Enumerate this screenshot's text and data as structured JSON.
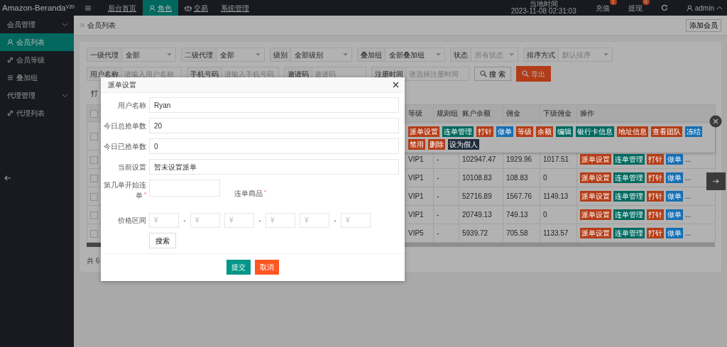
{
  "top_bar": {
    "logo": "Amazon-Beranda",
    "version": "V20",
    "nav": [
      {
        "label": "后台首页",
        "selected": false
      },
      {
        "label": "角色",
        "selected": true
      },
      {
        "label": "交易",
        "selected": false
      },
      {
        "label": "系统管理",
        "selected": false
      }
    ],
    "time_label": "当地时间",
    "time": "2023-11-08 02:31:03",
    "actions": [
      {
        "label": "充值",
        "badge": "1"
      },
      {
        "label": "提现",
        "badge": "0"
      }
    ],
    "user": "admin"
  },
  "sidebar": {
    "groups": [
      {
        "label": "会员管理",
        "expanded": true,
        "children": [
          {
            "label": "会员列表",
            "selected": true
          },
          {
            "label": "会员等级",
            "selected": false
          },
          {
            "label": "叠加组",
            "selected": false
          }
        ]
      },
      {
        "label": "代理管理",
        "expanded": true,
        "children": [
          {
            "label": "代理列表",
            "selected": false
          }
        ]
      }
    ]
  },
  "breadcrumb": "会员列表",
  "add_button": "添加会员",
  "filters": {
    "selects": [
      {
        "label": "一级代理",
        "value": "全部"
      },
      {
        "label": "二级代理",
        "value": "全部"
      },
      {
        "label": "级别",
        "value": "全部级别"
      },
      {
        "label": "叠加组",
        "value": "全部叠加组"
      },
      {
        "label": "状态",
        "placeholder": "所有状态"
      },
      {
        "label": "排序方式",
        "placeholder": "默认排序"
      }
    ],
    "inputs": [
      {
        "label": "用户名称",
        "placeholder": "请输入用户名称"
      },
      {
        "label": "手机号码",
        "placeholder": "请输入手机号码"
      },
      {
        "label": "邀请码",
        "placeholder": "邀请码"
      },
      {
        "label": "注册时间",
        "placeholder": "请选择注册时间"
      }
    ],
    "search_button": "搜 索",
    "export_button": "导出",
    "row_3_text": "打"
  },
  "table": {
    "header_checked": false,
    "columns": [
      "等级",
      "规则组",
      "账户余额",
      "佣金",
      "下级佣金",
      "操作"
    ],
    "rows": [
      {
        "checked": false
      },
      {
        "checked": false,
        "cells": [
          "VIP1",
          "-",
          "102947.47",
          "1929.96",
          "1017.51"
        ],
        "actions": [
          {
            "label": "派单设置",
            "color": "#b33d18"
          },
          {
            "label": "连单管理",
            "color": "#00695f"
          },
          {
            "label": "打针",
            "color": "#b33d18"
          },
          {
            "label": "做单",
            "color": "#156fb3"
          }
        ],
        "more": "..."
      },
      {
        "checked": false,
        "cells": [
          "VIP1",
          "-",
          "10108.83",
          "108.83",
          "0"
        ],
        "actions": [
          {
            "label": "派单设置",
            "color": "#b33d18"
          },
          {
            "label": "连单管理",
            "color": "#00695f"
          },
          {
            "label": "打针",
            "color": "#b33d18"
          },
          {
            "label": "做单",
            "color": "#156fb3"
          }
        ],
        "more": "..."
      },
      {
        "checked": false,
        "cells": [
          "VIP1",
          "-",
          "52716.89",
          "1567.76",
          "1149.13"
        ],
        "actions": [
          {
            "label": "派单设置",
            "color": "#b33d18"
          },
          {
            "label": "连单管理",
            "color": "#00695f"
          },
          {
            "label": "打针",
            "color": "#b33d18"
          },
          {
            "label": "做单",
            "color": "#156fb3"
          }
        ],
        "more": "..."
      },
      {
        "checked": false,
        "cells": [
          "VIP1",
          "-",
          "20749.13",
          "749.13",
          "0"
        ],
        "actions": [
          {
            "label": "派单设置",
            "color": "#b33d18"
          },
          {
            "label": "连单管理",
            "color": "#00695f"
          },
          {
            "label": "打针",
            "color": "#b33d18"
          },
          {
            "label": "做单",
            "color": "#156fb3"
          }
        ],
        "more": "..."
      },
      {
        "checked": false,
        "cells": [
          "VIP5",
          "-",
          "5939.72",
          "705.58",
          "1133.57"
        ],
        "actions": [
          {
            "label": "派单设置",
            "color": "#b33d18"
          },
          {
            "label": "连单管理",
            "color": "#00695f"
          },
          {
            "label": "打针",
            "color": "#b33d18"
          },
          {
            "label": "做单",
            "color": "#156fb3"
          }
        ],
        "more": "..."
      }
    ],
    "footer": "共 6"
  },
  "action_popup": {
    "buttons": [
      {
        "label": "派单设置",
        "color": "#b33d18"
      },
      {
        "label": "连单管理",
        "color": "#00695f"
      },
      {
        "label": "打针",
        "color": "#b33d18"
      },
      {
        "label": "做单",
        "color": "#156fb3"
      },
      {
        "label": "等级",
        "color": "#b33d18"
      },
      {
        "label": "余额",
        "color": "#b33d18"
      },
      {
        "label": "编辑",
        "color": "#00695f"
      },
      {
        "label": "银行卡信息",
        "color": "#00695f"
      },
      {
        "label": "地址信息",
        "color": "#b33d18"
      },
      {
        "label": "查看团队",
        "color": "#b33d18"
      },
      {
        "label": "冻结",
        "color": "#156fb3"
      },
      {
        "label": "禁用",
        "color": "#b33d18"
      },
      {
        "label": "删除",
        "color": "#b33d18"
      },
      {
        "label": "设为假人",
        "color": "#212d3c"
      }
    ]
  },
  "dialog": {
    "title": "派单设置",
    "fields": [
      {
        "label": "用户名称",
        "value": "Ryan"
      },
      {
        "label": "今日总抢单数",
        "value": "20"
      },
      {
        "label": "今日已抢单数",
        "value": "0"
      },
      {
        "label": "当前设置",
        "value": "暂未设置派单"
      }
    ],
    "start_order": {
      "label": "第几单开始连单",
      "required_mark": "*"
    },
    "products": {
      "label": "连单商品",
      "required_mark": "*"
    },
    "price_range": {
      "label": "价格区间",
      "pairs": [
        {
          "from_placeholder": "¥",
          "separator": "-",
          "to_placeholder": "¥"
        },
        {
          "from_placeholder": "¥",
          "separator": "-",
          "to_placeholder": "¥"
        },
        {
          "from_placeholder": "¥",
          "separator": "-",
          "to_placeholder": "¥"
        }
      ]
    },
    "search_button": "搜索",
    "submit_button": "提交",
    "cancel_button": "取消"
  }
}
